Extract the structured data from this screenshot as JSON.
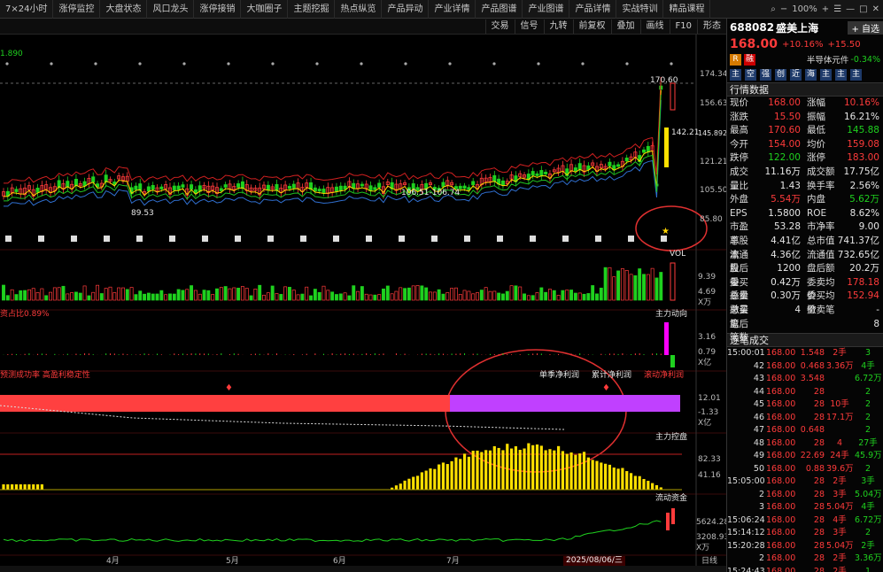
{
  "nav": {
    "tabs": [
      "7×24小时",
      "涨停监控",
      "大盘状态",
      "风口龙头",
      "涨停接销",
      "大咖圈子",
      "主题挖掘",
      "热点纵览",
      "产品异动",
      "产业详情",
      "产品图谱",
      "产业图谱",
      "产品详情",
      "实战特训",
      "精品课程"
    ]
  },
  "window": {
    "zoom": "100%"
  },
  "toolbar": {
    "items": [
      "交易",
      "信号",
      "九转",
      "前复权",
      "叠加",
      "画线",
      "F10",
      "形态"
    ]
  },
  "chart": {
    "top_label": "1.890",
    "price_axis": [
      "174.34",
      "156.63",
      "121.21",
      "105.50",
      "85.80"
    ],
    "high_label": "170.60",
    "mark_label": "142.21",
    "mark_label2": "145.892",
    "range_label": "106.51-106.74",
    "low_label": "89.53",
    "vol_title": "VOL",
    "vol_axis": [
      "9.39",
      "4.69",
      "X万"
    ],
    "capital_title": "主力动向",
    "capital_left": "资占比0.89%",
    "capital_axis": [
      "3.16",
      "0.79",
      "X亿"
    ],
    "profit_left": "预测成功率  高盈利稳定性",
    "profit_tabs": [
      "单季净利润",
      "累计净利润",
      "滚动净利润"
    ],
    "profit_axis": [
      "12.01",
      "-1.33",
      "X亿"
    ],
    "control_title": "主力控盘",
    "control_axis": [
      "82.33",
      "41.16"
    ],
    "flow_title": "流动资金",
    "flow_axis": [
      "5624.28",
      "3208.93",
      "X万"
    ],
    "months": [
      "4月",
      "5月",
      "6月",
      "7月"
    ],
    "date_label": "2025/08/06/三",
    "period": "日线"
  },
  "stock": {
    "code": "688082",
    "name": "盛美上海",
    "watch_btn": "自选",
    "price": "168.00",
    "chg_pct": "+10.16%",
    "chg": "+15.50",
    "sector": "半导体元件",
    "sector_chg": "-0.34%",
    "badges": [
      "R",
      "融"
    ],
    "tags": [
      "主",
      "空",
      "强",
      "创",
      "近",
      "海",
      "主",
      "主",
      "主"
    ]
  },
  "quote": {
    "title": "行情数据",
    "rows": [
      {
        "k": "现价",
        "v": "168.00",
        "vc": "red",
        "k2": "涨幅",
        "v2": "10.16%",
        "vc2": "red"
      },
      {
        "k": "涨跌",
        "v": "15.50",
        "vc": "red",
        "k2": "振幅",
        "v2": "16.21%",
        "vc2": "wht"
      },
      {
        "k": "最高",
        "v": "170.60",
        "vc": "red",
        "k2": "最低",
        "v2": "145.88",
        "vc2": "grn"
      },
      {
        "k": "今开",
        "v": "154.00",
        "vc": "red",
        "k2": "均价",
        "v2": "159.08",
        "vc2": "red"
      },
      {
        "k": "跌停",
        "v": "122.00",
        "vc": "grn",
        "k2": "涨停",
        "v2": "183.00",
        "vc2": "red"
      },
      {
        "k": "成交量",
        "v": "11.16万",
        "vc": "wht",
        "k2": "成交额",
        "v2": "17.75亿",
        "vc2": "wht"
      },
      {
        "k": "量比",
        "v": "1.43",
        "vc": "wht",
        "k2": "换手率",
        "v2": "2.56%",
        "vc2": "wht"
      },
      {
        "k": "外盘",
        "v": "5.54万",
        "vc": "red",
        "k2": "内盘",
        "v2": "5.62万",
        "vc2": "grn"
      },
      {
        "k": "EPS",
        "v": "1.5800",
        "vc": "wht",
        "k2": "ROE",
        "v2": "8.62%",
        "vc2": "wht"
      },
      {
        "k": "市盈率",
        "v": "53.28",
        "vc": "wht",
        "k2": "市净率",
        "v2": "9.00",
        "vc2": "wht"
      },
      {
        "k": "总股本",
        "v": "4.41亿",
        "vc": "wht",
        "k2": "总市值",
        "v2": "741.37亿",
        "vc2": "wht"
      },
      {
        "k": "流通股",
        "v": "4.36亿",
        "vc": "wht",
        "k2": "流通值",
        "v2": "732.65亿",
        "vc2": "wht"
      },
      {
        "k": "盘后量",
        "v": "1200",
        "vc": "wht",
        "k2": "盘后额",
        "v2": "20.2万",
        "vc2": "wht"
      },
      {
        "k": "委买总量",
        "v": "0.42万",
        "vc": "wht",
        "k2": "委卖均价",
        "v2": "178.18",
        "vc2": "red"
      },
      {
        "k": "委卖总量",
        "v": "0.30万",
        "vc": "wht",
        "k2": "委买均价",
        "v2": "152.94",
        "vc2": "red"
      },
      {
        "k": "撤买笔",
        "v": "4",
        "vc": "wht",
        "k2": "撤卖笔",
        "v2": "-",
        "vc2": "wht"
      },
      {
        "k": "盘后笔数",
        "v": "",
        "vc": "wht",
        "k2": "",
        "v2": "8",
        "vc2": "wht"
      }
    ]
  },
  "trades": {
    "title": "逐笔成交",
    "rows": [
      {
        "t": "15:00:01",
        "p": "168.00",
        "v": "1.548",
        "h": "2手",
        "x": "3"
      },
      {
        "t": "42",
        "p": "168.00",
        "v": "0.468",
        "h": "3.36万",
        "x": "4手"
      },
      {
        "t": "43",
        "p": "168.00",
        "v": "3.548",
        "h": "",
        "x": "6.72万"
      },
      {
        "t": "44",
        "p": "168.00",
        "v": "28",
        "h": "",
        "x": "2"
      },
      {
        "t": "45",
        "p": "168.00",
        "v": "28",
        "h": "10手",
        "x": "2"
      },
      {
        "t": "46",
        "p": "168.00",
        "v": "28",
        "h": "17.1万",
        "x": "2"
      },
      {
        "t": "47",
        "p": "168.00",
        "v": "0.648",
        "h": "",
        "x": "2"
      },
      {
        "t": "48",
        "p": "168.00",
        "v": "28",
        "h": "4",
        "x": "27手"
      },
      {
        "t": "49",
        "p": "168.00",
        "v": "22.69",
        "h": "24手",
        "x": "45.9万"
      },
      {
        "t": "50",
        "p": "168.00",
        "v": "0.88",
        "h": "39.6万",
        "x": "2"
      },
      {
        "t": "15:05:00",
        "p": "168.00",
        "v": "28",
        "h": "2手",
        "x": "3手"
      },
      {
        "t": "2",
        "p": "168.00",
        "v": "28",
        "h": "3手",
        "x": "5.04万"
      },
      {
        "t": "3",
        "p": "168.00",
        "v": "28",
        "h": "5.04万",
        "x": "4手"
      },
      {
        "t": "15:06:24",
        "p": "168.00",
        "v": "28",
        "h": "4手",
        "x": "6.72万"
      },
      {
        "t": "15:14:12",
        "p": "168.00",
        "v": "28",
        "h": "3手",
        "x": "2"
      },
      {
        "t": "15:20:28",
        "p": "168.00",
        "v": "28",
        "h": "5.04万",
        "x": "2手"
      },
      {
        "t": "2",
        "p": "168.00",
        "v": "28",
        "h": "2手",
        "x": "3.36万"
      },
      {
        "t": "15:24:43",
        "p": "168.00",
        "v": "28",
        "h": "2手",
        "x": "1"
      }
    ]
  },
  "colors": {
    "up": "#ff3b3b",
    "down": "#1fd11f",
    "accent": "#d43bff",
    "yellow": "#ffd400",
    "circle": "#e03030"
  }
}
